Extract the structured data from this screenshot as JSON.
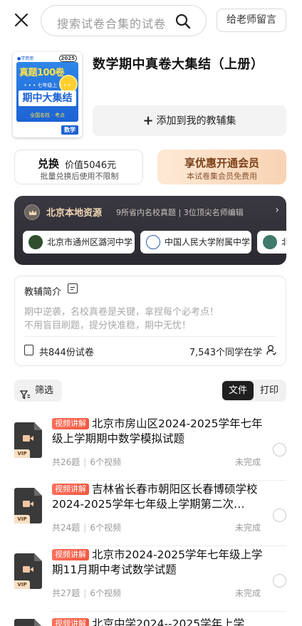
{
  "header": {
    "search_placeholder": "搜索试卷合集的试卷",
    "message_button": "给老师留言"
  },
  "book": {
    "cover": {
      "brand": "●学而思",
      "year": "2025",
      "title_top": "真题100卷",
      "grade": "• • •  七年级上  • • •",
      "title_main": "期中大集结",
      "tagline": "全国名校 · 考点",
      "subject": "数学"
    },
    "title": "数学期中真卷大集结（上册）",
    "add_button": "添加到我的教辅集"
  },
  "exchange": {
    "title": "兑换",
    "value": "价值5046元",
    "subtitle": "批量兑换后使用不限制"
  },
  "vip": {
    "title": "享优惠开通会员",
    "subtitle": "本试卷集会员免费用",
    "colors": {
      "text": "#7a3f17",
      "bg_from": "#fde9d6",
      "bg_to": "#f8d3b3"
    }
  },
  "local": {
    "title": "北京本地资源",
    "desc": "9所省内名校真题 | 3位顶尖名师编辑",
    "schools": [
      "北京市通州区潞河中学",
      "中国人民大学附属中学",
      "北"
    ]
  },
  "intro": {
    "title": "教辅简介",
    "lines": [
      "期中逆袭，名校真卷是关键，拿捏每个必考点！",
      "不用盲目刷题，提分快准稳，期中无忧！"
    ],
    "count": "共844份试卷",
    "learners": "7,543个同学在学"
  },
  "filter": {
    "label": "筛选",
    "tabs": [
      "文件",
      "打印"
    ],
    "active_tab": "文件"
  },
  "items": [
    {
      "badge": "视频讲解",
      "title": "北京市房山区2024-2025学年七年级上学期期中数学模拟试题",
      "questions": "共26题",
      "videos": "6个视频",
      "status": "未完成"
    },
    {
      "badge": "视频讲解",
      "title": "吉林省长春市朝阳区长春博硕学校2024-2025学年七年级上学期第二次…",
      "questions": "共24题",
      "videos": "6个视频",
      "status": "未完成"
    },
    {
      "badge": "视频讲解",
      "title": "北京市2024-2025学年七年级上学期11月期中考试数学试题",
      "questions": "共27题",
      "videos": "6个视频",
      "status": "未完成"
    },
    {
      "badge": "视频讲解",
      "title": "北京中学2024--2025学年上学",
      "questions": "",
      "videos": "",
      "status": ""
    }
  ],
  "file_badge": "VIP",
  "colors": {
    "badge": "#f2583f",
    "accent_dark": "#1f1f1f"
  },
  "icons": [
    "close-icon",
    "search-icon",
    "plus-icon",
    "crown-icon",
    "chevron-right-icon",
    "edit-icon",
    "book-icon",
    "user-icon",
    "filter-icon",
    "video-file-icon"
  ]
}
